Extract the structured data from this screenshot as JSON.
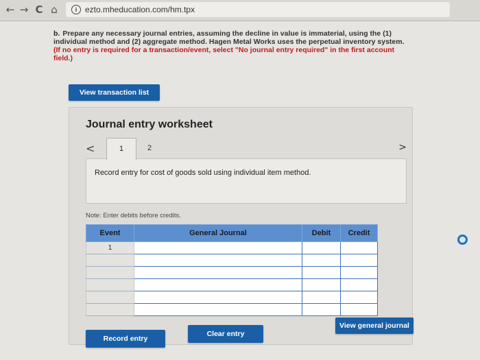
{
  "browser": {
    "back_glyph": "←",
    "forward_glyph": "→",
    "reload_glyph": "C",
    "home_glyph": "⌂",
    "info_glyph": "i",
    "url": "ezto.mheducation.com/hm.tpx"
  },
  "instructions": {
    "part": "b.",
    "text": "Prepare any necessary journal entries, assuming the decline in value is immaterial, using the (1) individual method and (2) aggregate method. Hagen Metal Works uses the perpetual inventory system.",
    "note": "(If no entry is required for a transaction/event, select \"No journal entry required\" in the first account field.)"
  },
  "buttons": {
    "view_transaction_list": "View transaction list",
    "record_entry": "Record entry",
    "clear_entry": "Clear entry",
    "view_general_journal": "View general journal"
  },
  "worksheet": {
    "title": "Journal entry worksheet",
    "prev_glyph": "<",
    "next_glyph": ">",
    "tabs": [
      "1",
      "2"
    ],
    "active_tab": "1",
    "description": "Record entry for cost of goods sold using individual item method.",
    "note": "Note: Enter debits before credits."
  },
  "journal_table": {
    "headers": {
      "event": "Event",
      "general_journal": "General Journal",
      "debit": "Debit",
      "credit": "Credit"
    },
    "rows": [
      {
        "event": "1",
        "account": "",
        "debit": "",
        "credit": ""
      },
      {
        "event": "",
        "account": "",
        "debit": "",
        "credit": ""
      },
      {
        "event": "",
        "account": "",
        "debit": "",
        "credit": ""
      },
      {
        "event": "",
        "account": "",
        "debit": "",
        "credit": ""
      },
      {
        "event": "",
        "account": "",
        "debit": "",
        "credit": ""
      },
      {
        "event": "",
        "account": "",
        "debit": "",
        "credit": ""
      }
    ]
  },
  "colors": {
    "primary_button": "#1a5fa6",
    "table_header": "#5b8fd0",
    "note_red": "#c21a1a",
    "radio_blue": "#1a74c9"
  }
}
